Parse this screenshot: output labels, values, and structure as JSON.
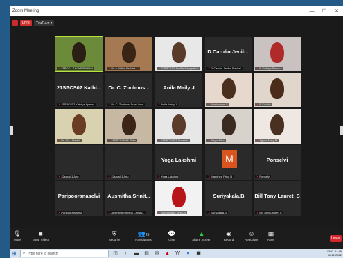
{
  "window": {
    "title": "Zoom Meeting",
    "minimize": "—",
    "maximize": "☐",
    "close": "✕"
  },
  "livebar": {
    "live_label": "LIVE",
    "youtube_label": "YouTube ▾"
  },
  "participants": [
    {
      "big": "",
      "label": "21PCS... 1SCKRISHNAN",
      "video": true
    },
    {
      "big": "",
      "label": "Dr. A. Mitha Prabha ...",
      "video": true
    },
    {
      "big": "",
      "label": "22SPCS02 Jenifer Sangeetha",
      "video": true
    },
    {
      "big": "D.Carolin  Jenib...",
      "label": "D.Carolin Jeniba Rachel",
      "video": false
    },
    {
      "big": "",
      "label": "N.Sathiya Renuka",
      "video": true
    },
    {
      "big": "21SPCS02  Kathi...",
      "label": "21SPCS02 Kathiya Aparna",
      "video": false
    },
    {
      "big": "Dr. C. Zoolmus...",
      "label": "Dr. C. Zoolmus Jhasi Loke",
      "video": false
    },
    {
      "big": "Anila Maily J",
      "label": "Anila Maily J",
      "video": false
    },
    {
      "big": "",
      "label": "Muniammal S",
      "video": true
    },
    {
      "big": "",
      "label": "R.Kalathi",
      "video": true
    },
    {
      "big": "",
      "label": "Dr. Ch... Rajath",
      "video": true
    },
    {
      "big": "",
      "label": "21SPCS06 Ali Shifa",
      "video": true
    },
    {
      "big": "",
      "label": "21SPCS08 T Sharmila",
      "video": true
    },
    {
      "big": "",
      "label": "Naguchitra",
      "video": true
    },
    {
      "big": "",
      "label": "Agnes Mary M",
      "video": true
    },
    {
      "big": "",
      "label": "22spcs01 Anu",
      "video": false
    },
    {
      "big": "",
      "label": "22spcs01 Anu",
      "video": false
    },
    {
      "big": "Yoga Lakshmi",
      "label": "Yoga Lakshmi",
      "video": false
    },
    {
      "big": "M",
      "label": "Mandhira Priya B",
      "video": false
    },
    {
      "big": "Ponselvi",
      "label": "Ponselvi",
      "video": false
    },
    {
      "big": "Paripooranaselvi",
      "label": "Paripooranaselvi",
      "video": false
    },
    {
      "big": "Ausmitha  Srinit...",
      "label": "Ausmitha Srinitha Christy...",
      "video": false
    },
    {
      "big": "",
      "label": "Sandhiya M SPECS",
      "video": true
    },
    {
      "big": "Suriyakala.B",
      "label": "Suriyakala.B",
      "video": false
    },
    {
      "big": "Bill Tony Lauret. S",
      "label": "Bill Tony Lauret. S",
      "video": false
    }
  ],
  "toolbar": {
    "mute": "Mute",
    "stop_video": "Stop Video",
    "security": "Security",
    "participants": "Participants",
    "participants_count": "25",
    "chat": "Chat",
    "chat_count": "2",
    "share_screen": "Share Screen",
    "record": "Record",
    "reactions": "Reactions",
    "apps": "Apps",
    "leave": "Leave"
  },
  "taskbar": {
    "search_placeholder": "Type here to search",
    "time": "11:46",
    "date": "12-11-2022",
    "lang": "ENG"
  },
  "colors": {
    "active_speaker": "#b8e23c",
    "leave": "#d3262f",
    "live": "#d0312d",
    "avatar_m": "#d9541e"
  }
}
